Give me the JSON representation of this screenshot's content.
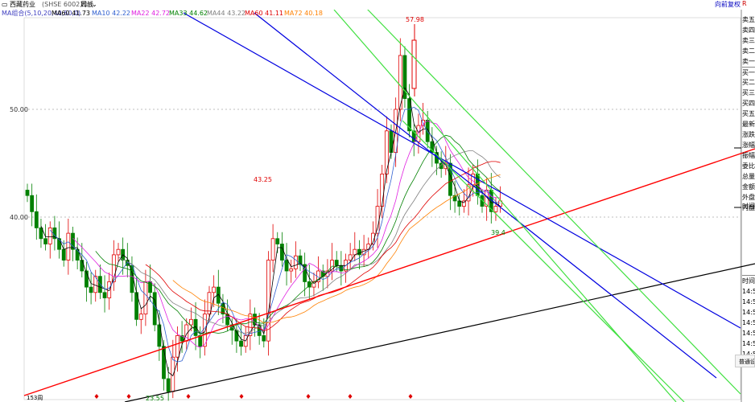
{
  "header": {
    "stock_name": "西藏药业",
    "stock_code": "(SHSE 600211)",
    "period": "周线",
    "right_link": "向前复权",
    "right_tag": "R"
  },
  "ma_legend": [
    {
      "label": "MA组合(5,10,20,40,60,0)",
      "color": "#4040c0"
    },
    {
      "label": "MA60 41.73",
      "color": "#000000"
    },
    {
      "label": "MA10 42.22",
      "color": "#3060d0"
    },
    {
      "label": "MA22 42.72",
      "color": "#e020e0"
    },
    {
      "label": "MA33 44.62",
      "color": "#008000"
    },
    {
      "label": "MA44 43.22",
      "color": "#808080"
    },
    {
      "label": "MA60 41.11",
      "color": "#e00000"
    },
    {
      "label": "MA72 40.18",
      "color": "#ff8000"
    }
  ],
  "y_axis": [
    "50.00",
    "40.00"
  ],
  "annotations": {
    "high": "57.98",
    "mid_high": "43.25",
    "low": "23.55",
    "recent_low": "39.4"
  },
  "bottom_label": "153周",
  "right_panel_quote": [
    "卖五",
    "卖四",
    "卖三",
    "卖二",
    "卖一",
    "买一",
    "买二",
    "买三",
    "买四",
    "买五",
    "最新",
    "涨跌",
    "涨幅",
    "振幅",
    "委比",
    "总量",
    "金额",
    "外盘",
    "内盘"
  ],
  "right_panel_misc": {
    "time_label": "时间",
    "time_header": "时间",
    "times": [
      "14:5",
      "14:5",
      "14:5",
      "14:5",
      "14:5",
      "14:5",
      "14:5",
      "14:5"
    ],
    "tab": "普通设"
  },
  "chart_data": {
    "type": "candlestick",
    "period": "weekly",
    "ylabels": [
      "50.00",
      "40.00"
    ],
    "high_label": "57.98",
    "low_label": "23.55",
    "other_labels": [
      "43.25",
      "39.4"
    ]
  },
  "colors": {
    "up": "#e00000",
    "down": "#008000",
    "red_line": "#ff0000",
    "blue_line": "#0000e0",
    "green_line": "#40e040",
    "black_line": "#000000"
  }
}
